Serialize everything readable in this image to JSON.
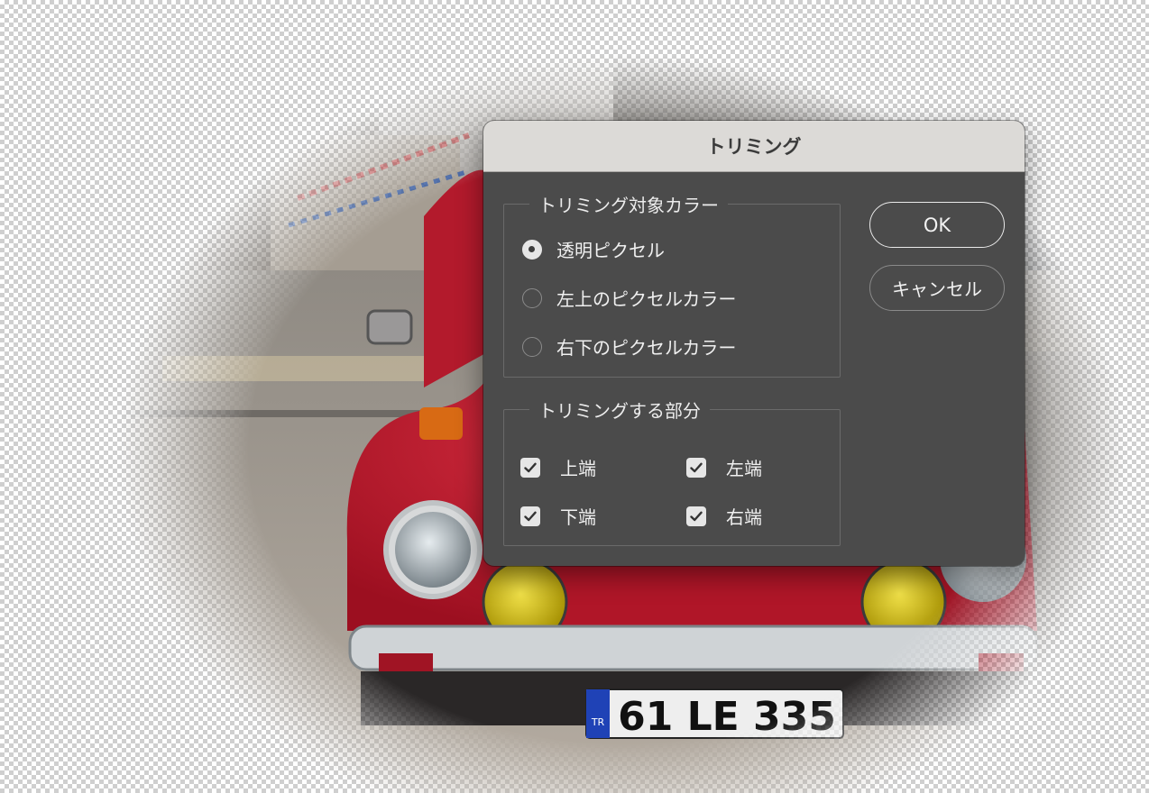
{
  "dialog": {
    "title": "トリミング",
    "ok_label": "OK",
    "cancel_label": "キャンセル",
    "color_group": {
      "legend": "トリミング対象カラー",
      "options": [
        {
          "label": "透明ピクセル",
          "selected": true
        },
        {
          "label": "左上のピクセルカラー",
          "selected": false
        },
        {
          "label": "右下のピクセルカラー",
          "selected": false
        }
      ]
    },
    "trim_group": {
      "legend": "トリミングする部分",
      "items": [
        {
          "label": "上端",
          "checked": true
        },
        {
          "label": "左端",
          "checked": true
        },
        {
          "label": "下端",
          "checked": true
        },
        {
          "label": "右端",
          "checked": true
        }
      ]
    }
  },
  "photo": {
    "plate": {
      "country": "TR",
      "number": "61 LE 335"
    },
    "car_color": "#c4172b",
    "headlight_color": "#c9b500"
  }
}
